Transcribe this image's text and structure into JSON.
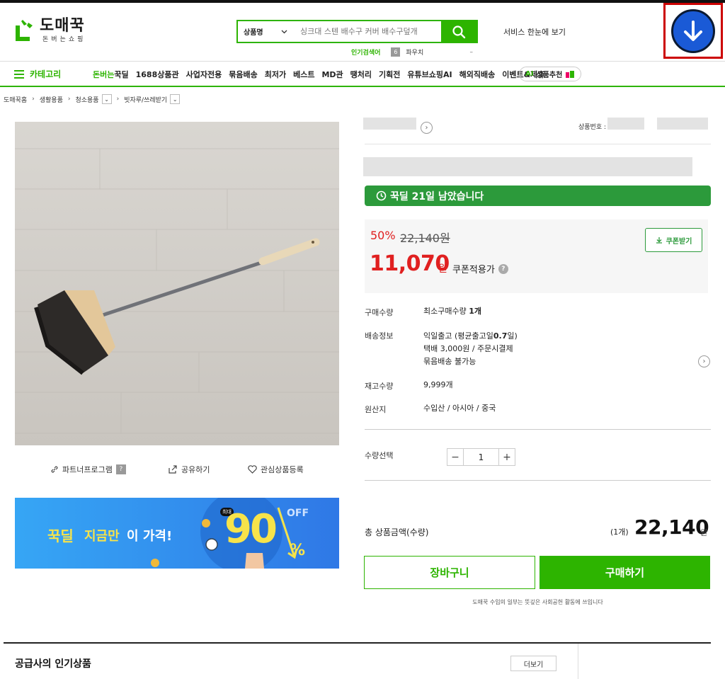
{
  "header": {
    "logo_title": "도매꾹",
    "logo_sub": "돈버는쇼핑",
    "search_category": "상품명",
    "search_placeholder": "싱크대 스텐 배수구 커버 배수구덮개",
    "trending_label": "인기검색어",
    "trending_rank": "6",
    "trending_word": "파우치",
    "trending_dash": "–",
    "service_link": "서비스 한눈에 보기"
  },
  "nav": {
    "category_label": "카테고리",
    "items": [
      {
        "prefix": "돈버는",
        "label": "꾹딜"
      },
      {
        "label": "1688상품관"
      },
      {
        "label": "사업자전용"
      },
      {
        "label": "묶음배송"
      },
      {
        "label": "최저가"
      },
      {
        "label": "베스트"
      },
      {
        "label": "MD관"
      },
      {
        "label": "땡처리"
      },
      {
        "label": "기획전"
      },
      {
        "label": "유튜브쇼핑AI"
      },
      {
        "label": "해외직배송"
      },
      {
        "label": "이벤트&제휴"
      }
    ],
    "ai_prefix": "AI",
    "ai_label": "상품추천"
  },
  "breadcrumb": [
    "도매꾹홈",
    "생활용품",
    "청소용품",
    "빗자루/쓰레받기"
  ],
  "product": {
    "id_label": "상품번호 :",
    "deal_banner": "꾹딜 21일 남았습니다",
    "discount": "50%",
    "original_price": "22,140원",
    "sale_price": "11,070",
    "sale_won": "원",
    "coupon_price_label": "쿠폰적용가",
    "coupon_button": "쿠폰받기",
    "info": {
      "purchase_qty_label": "구매수량",
      "purchase_qty_prefix": "최소구매수량 ",
      "purchase_qty_value": "1개",
      "shipping_label": "배송정보",
      "shipping_line1_prefix": "익일출고 (평균출고일",
      "shipping_line1_bold": "0.7",
      "shipping_line1_suffix": "일)",
      "shipping_line2": "택배 3,000원 / 주문시결제",
      "shipping_line3": "묶음배송 불가능",
      "stock_label": "재고수량",
      "stock_value": "9,999개",
      "origin_label": "원산지",
      "origin_value": "수입산 / 아시아 / 중국"
    },
    "quantity_label": "수량선택",
    "quantity_value": "1",
    "minus": "−",
    "plus": "+",
    "total_label": "총 상품금액(수량)",
    "total_qty": "(1개)",
    "total_price": "22,140",
    "total_won": "원",
    "cart_button": "장바구니",
    "buy_button": "구매하기",
    "notice": "도매꾹 수입의 일부는 뜻깊은 사회공헌 활동에 쓰입니다"
  },
  "image_actions": {
    "partner": "파트너프로그램",
    "partner_badge": "?",
    "share": "공유하기",
    "wishlist": "관심상품등록"
  },
  "promo_banner": {
    "text1": "꾹딜",
    "text2": "지금만",
    "text3": "이 가격!",
    "badge": "최대",
    "percent": "90",
    "off": "OFF"
  },
  "supplier": {
    "title": "공급사의 인기상품",
    "more_button": "더보기"
  },
  "colors": {
    "brand_green": "#2db400",
    "deal_green": "#2c9a3b",
    "sale_red": "#e02020",
    "download_blue": "#1a5ad6",
    "highlight_red": "#cc0000"
  }
}
